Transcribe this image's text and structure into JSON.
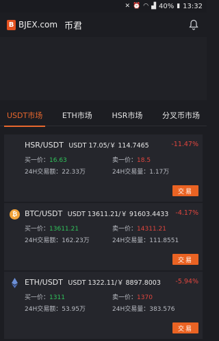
{
  "statusbar": {
    "battery": "40%",
    "time": "13:32"
  },
  "header": {
    "brand": "BJEX.com",
    "brand_cn": "币君"
  },
  "tabs": [
    "USDT市场",
    "ETH市场",
    "HSR市场",
    "分叉币市场"
  ],
  "colors": {
    "accent": "#e9682e",
    "up": "#30c35b",
    "down": "#e2463e",
    "button": "#ea6323"
  },
  "markets": [
    {
      "pair": "HSR/USDT",
      "price": "USDT 17.05/￥ 114.7465",
      "change": "-11.47%",
      "buy_label": "买一价：",
      "buy_value": "16.63",
      "sell_label": "卖一价：",
      "sell_value": "18.5",
      "volume_label": "24H交易额：",
      "volume_value": "22.33万",
      "qty_label": "24H交易量：",
      "qty_value": "1.17万",
      "button": "交易"
    },
    {
      "pair": "BTC/USDT",
      "price": "USDT 13611.21/￥ 91603.4433",
      "change": "-4.17%",
      "buy_label": "买一价：",
      "buy_value": "13611.21",
      "sell_label": "卖一价：",
      "sell_value": "14311.21",
      "volume_label": "24H交易额：",
      "volume_value": "162.23万",
      "qty_label": "24H交易量：",
      "qty_value": "111.8551",
      "button": "交易"
    },
    {
      "pair": "ETH/USDT",
      "price": "USDT 1322.11/￥ 8897.8003",
      "change": "-5.94%",
      "buy_label": "买一价：",
      "buy_value": "1311",
      "sell_label": "卖一价：",
      "sell_value": "1370",
      "volume_label": "24H交易额：",
      "volume_value": "53.95万",
      "qty_label": "24H交易量：",
      "qty_value": "383.576",
      "button": "交易"
    }
  ]
}
